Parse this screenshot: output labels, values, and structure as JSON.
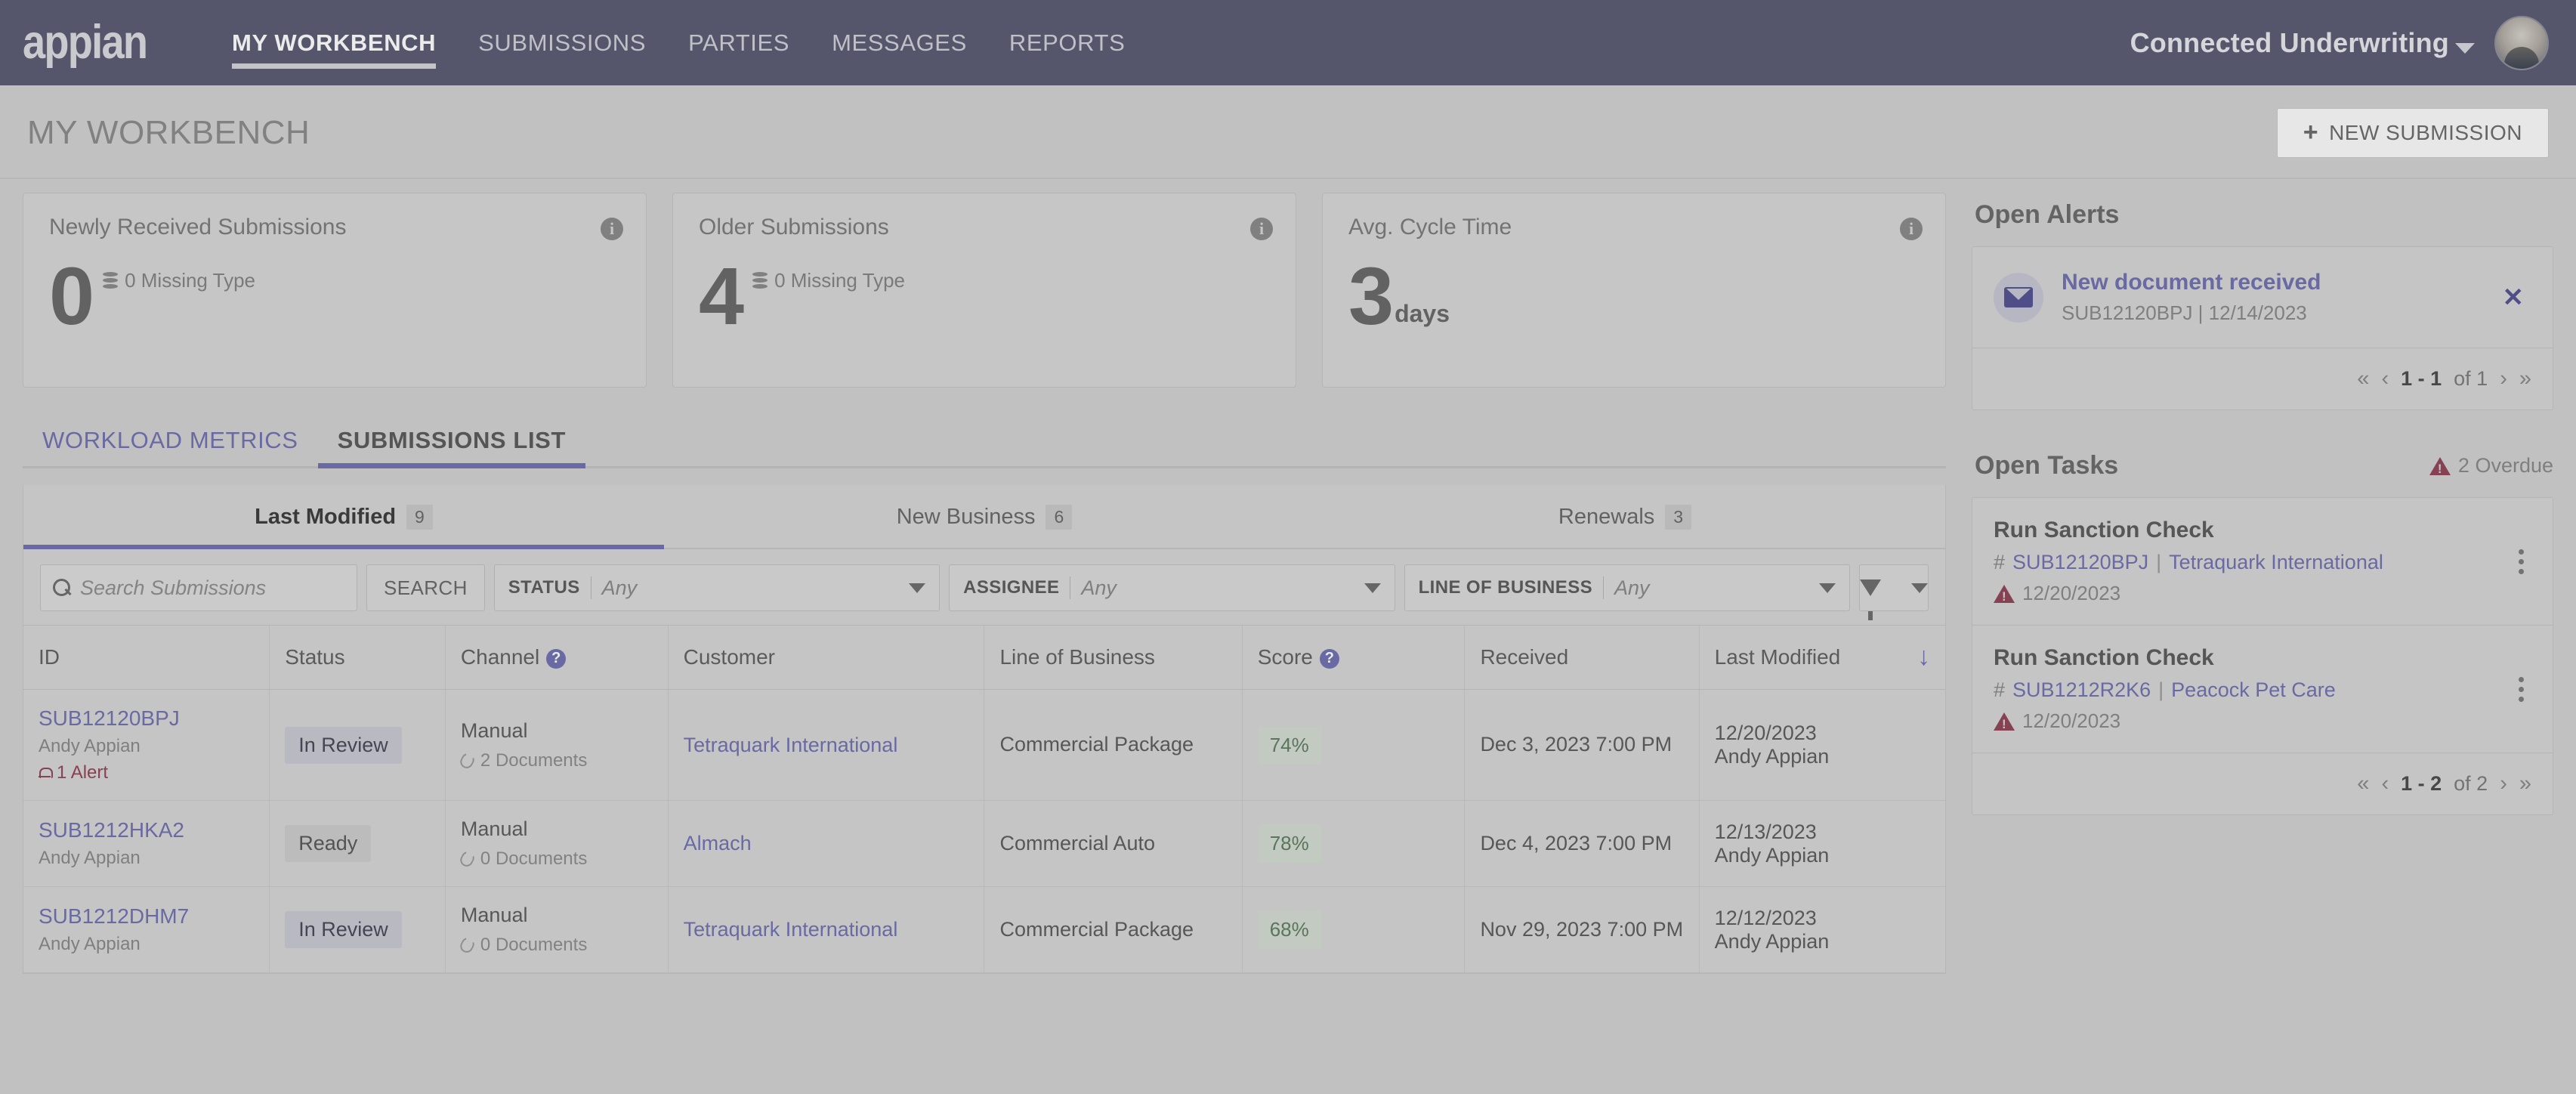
{
  "topnav": {
    "brand": "appian",
    "links": [
      {
        "label": "MY WORKBENCH",
        "active": true
      },
      {
        "label": "SUBMISSIONS",
        "active": false
      },
      {
        "label": "PARTIES",
        "active": false
      },
      {
        "label": "MESSAGES",
        "active": false
      },
      {
        "label": "REPORTS",
        "active": false
      }
    ],
    "user_menu": "Connected Underwriting"
  },
  "pagehead": {
    "title": "MY WORKBENCH",
    "new_submission_label": "NEW SUBMISSION",
    "plus": "+"
  },
  "metrics": [
    {
      "title": "Newly Received Submissions",
      "value": "0",
      "sub": "0 Missing Type",
      "unit": ""
    },
    {
      "title": "Older Submissions",
      "value": "4",
      "sub": "0 Missing Type",
      "unit": ""
    },
    {
      "title": "Avg. Cycle Time",
      "value": "3",
      "sub": "",
      "unit": "days"
    }
  ],
  "main_tabs": [
    {
      "label": "WORKLOAD METRICS",
      "active": false
    },
    {
      "label": "SUBMISSIONS LIST",
      "active": true
    }
  ],
  "sub_tabs": [
    {
      "label": "Last Modified",
      "count": "9",
      "active": true
    },
    {
      "label": "New Business",
      "count": "6",
      "active": false
    },
    {
      "label": "Renewals",
      "count": "3",
      "active": false
    }
  ],
  "filters": {
    "search_placeholder": "Search Submissions",
    "search_value": "",
    "search_button": "SEARCH",
    "status": {
      "label": "STATUS",
      "value": "Any"
    },
    "assignee": {
      "label": "ASSIGNEE",
      "value": "Any"
    },
    "line_of_business": {
      "label": "LINE OF BUSINESS",
      "value": "Any"
    }
  },
  "table": {
    "columns": [
      {
        "label": "ID",
        "help": false
      },
      {
        "label": "Status",
        "help": false
      },
      {
        "label": "Channel",
        "help": true
      },
      {
        "label": "Customer",
        "help": false
      },
      {
        "label": "Line of Business",
        "help": false
      },
      {
        "label": "Score",
        "help": true
      },
      {
        "label": "Received",
        "help": false
      },
      {
        "label": "Last Modified",
        "help": false,
        "sorted": true
      }
    ],
    "sort_arrow": "↓",
    "help_glyph": "?",
    "rows": [
      {
        "id": "SUB12120BPJ",
        "owner": "Andy Appian",
        "alert": "1 Alert",
        "status": "In Review",
        "status_kind": "review",
        "channel": "Manual",
        "documents": "2 Documents",
        "customer": "Tetraquark International",
        "line_of_business": "Commercial Package",
        "score": "74%",
        "received": "Dec 3, 2023 7:00 PM",
        "last_modified_date": "12/20/2023",
        "last_modified_by": "Andy Appian"
      },
      {
        "id": "SUB1212HKA2",
        "owner": "Andy Appian",
        "alert": "",
        "status": "Ready",
        "status_kind": "ready",
        "channel": "Manual",
        "documents": "0 Documents",
        "customer": "Almach",
        "line_of_business": "Commercial Auto",
        "score": "78%",
        "received": "Dec 4, 2023 7:00 PM",
        "last_modified_date": "12/13/2023",
        "last_modified_by": "Andy Appian"
      },
      {
        "id": "SUB1212DHM7",
        "owner": "Andy Appian",
        "alert": "",
        "status": "In Review",
        "status_kind": "review",
        "channel": "Manual",
        "documents": "0 Documents",
        "customer": "Tetraquark International",
        "line_of_business": "Commercial Package",
        "score": "68%",
        "received": "Nov 29, 2023 7:00 PM",
        "last_modified_date": "12/12/2023",
        "last_modified_by": "Andy Appian"
      }
    ]
  },
  "open_alerts": {
    "heading": "Open Alerts",
    "items": [
      {
        "title": "New document received",
        "meta": "SUB12120BPJ | 12/14/2023",
        "close": "✕"
      }
    ],
    "pager": {
      "first": "«",
      "prev": "‹",
      "range": "1 - 1",
      "of": "of 1",
      "next": "›",
      "last": "»"
    }
  },
  "open_tasks": {
    "heading": "Open Tasks",
    "overdue": "2 Overdue",
    "items": [
      {
        "title": "Run Sanction Check",
        "hash": "#",
        "ref_id": "SUB12120BPJ",
        "pipe": "|",
        "customer": "Tetraquark International",
        "due": "12/20/2023"
      },
      {
        "title": "Run Sanction Check",
        "hash": "#",
        "ref_id": "SUB1212R2K6",
        "pipe": "|",
        "customer": "Peacock Pet Care",
        "due": "12/20/2023"
      }
    ],
    "pager": {
      "first": "«",
      "prev": "‹",
      "range": "1 - 2",
      "of": "of 2",
      "next": "›",
      "last": "»"
    }
  },
  "colors": {
    "nav_bg": "#5a5d85",
    "accent": "#6f6fe0",
    "page_bg": "#d2d2d2",
    "score_green": "#4e8750",
    "alert_red": "#c0395c"
  }
}
